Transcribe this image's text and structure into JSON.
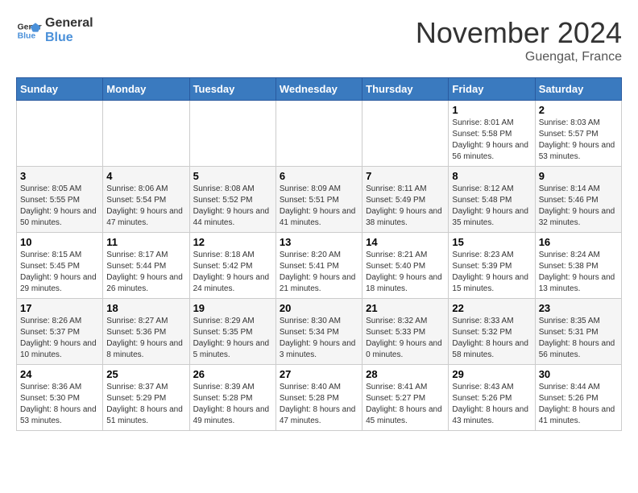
{
  "logo": {
    "line1": "General",
    "line2": "Blue"
  },
  "title": "November 2024",
  "location": "Guengat, France",
  "weekdays": [
    "Sunday",
    "Monday",
    "Tuesday",
    "Wednesday",
    "Thursday",
    "Friday",
    "Saturday"
  ],
  "weeks": [
    [
      {
        "day": "",
        "info": ""
      },
      {
        "day": "",
        "info": ""
      },
      {
        "day": "",
        "info": ""
      },
      {
        "day": "",
        "info": ""
      },
      {
        "day": "",
        "info": ""
      },
      {
        "day": "1",
        "info": "Sunrise: 8:01 AM\nSunset: 5:58 PM\nDaylight: 9 hours and 56 minutes."
      },
      {
        "day": "2",
        "info": "Sunrise: 8:03 AM\nSunset: 5:57 PM\nDaylight: 9 hours and 53 minutes."
      }
    ],
    [
      {
        "day": "3",
        "info": "Sunrise: 8:05 AM\nSunset: 5:55 PM\nDaylight: 9 hours and 50 minutes."
      },
      {
        "day": "4",
        "info": "Sunrise: 8:06 AM\nSunset: 5:54 PM\nDaylight: 9 hours and 47 minutes."
      },
      {
        "day": "5",
        "info": "Sunrise: 8:08 AM\nSunset: 5:52 PM\nDaylight: 9 hours and 44 minutes."
      },
      {
        "day": "6",
        "info": "Sunrise: 8:09 AM\nSunset: 5:51 PM\nDaylight: 9 hours and 41 minutes."
      },
      {
        "day": "7",
        "info": "Sunrise: 8:11 AM\nSunset: 5:49 PM\nDaylight: 9 hours and 38 minutes."
      },
      {
        "day": "8",
        "info": "Sunrise: 8:12 AM\nSunset: 5:48 PM\nDaylight: 9 hours and 35 minutes."
      },
      {
        "day": "9",
        "info": "Sunrise: 8:14 AM\nSunset: 5:46 PM\nDaylight: 9 hours and 32 minutes."
      }
    ],
    [
      {
        "day": "10",
        "info": "Sunrise: 8:15 AM\nSunset: 5:45 PM\nDaylight: 9 hours and 29 minutes."
      },
      {
        "day": "11",
        "info": "Sunrise: 8:17 AM\nSunset: 5:44 PM\nDaylight: 9 hours and 26 minutes."
      },
      {
        "day": "12",
        "info": "Sunrise: 8:18 AM\nSunset: 5:42 PM\nDaylight: 9 hours and 24 minutes."
      },
      {
        "day": "13",
        "info": "Sunrise: 8:20 AM\nSunset: 5:41 PM\nDaylight: 9 hours and 21 minutes."
      },
      {
        "day": "14",
        "info": "Sunrise: 8:21 AM\nSunset: 5:40 PM\nDaylight: 9 hours and 18 minutes."
      },
      {
        "day": "15",
        "info": "Sunrise: 8:23 AM\nSunset: 5:39 PM\nDaylight: 9 hours and 15 minutes."
      },
      {
        "day": "16",
        "info": "Sunrise: 8:24 AM\nSunset: 5:38 PM\nDaylight: 9 hours and 13 minutes."
      }
    ],
    [
      {
        "day": "17",
        "info": "Sunrise: 8:26 AM\nSunset: 5:37 PM\nDaylight: 9 hours and 10 minutes."
      },
      {
        "day": "18",
        "info": "Sunrise: 8:27 AM\nSunset: 5:36 PM\nDaylight: 9 hours and 8 minutes."
      },
      {
        "day": "19",
        "info": "Sunrise: 8:29 AM\nSunset: 5:35 PM\nDaylight: 9 hours and 5 minutes."
      },
      {
        "day": "20",
        "info": "Sunrise: 8:30 AM\nSunset: 5:34 PM\nDaylight: 9 hours and 3 minutes."
      },
      {
        "day": "21",
        "info": "Sunrise: 8:32 AM\nSunset: 5:33 PM\nDaylight: 9 hours and 0 minutes."
      },
      {
        "day": "22",
        "info": "Sunrise: 8:33 AM\nSunset: 5:32 PM\nDaylight: 8 hours and 58 minutes."
      },
      {
        "day": "23",
        "info": "Sunrise: 8:35 AM\nSunset: 5:31 PM\nDaylight: 8 hours and 56 minutes."
      }
    ],
    [
      {
        "day": "24",
        "info": "Sunrise: 8:36 AM\nSunset: 5:30 PM\nDaylight: 8 hours and 53 minutes."
      },
      {
        "day": "25",
        "info": "Sunrise: 8:37 AM\nSunset: 5:29 PM\nDaylight: 8 hours and 51 minutes."
      },
      {
        "day": "26",
        "info": "Sunrise: 8:39 AM\nSunset: 5:28 PM\nDaylight: 8 hours and 49 minutes."
      },
      {
        "day": "27",
        "info": "Sunrise: 8:40 AM\nSunset: 5:28 PM\nDaylight: 8 hours and 47 minutes."
      },
      {
        "day": "28",
        "info": "Sunrise: 8:41 AM\nSunset: 5:27 PM\nDaylight: 8 hours and 45 minutes."
      },
      {
        "day": "29",
        "info": "Sunrise: 8:43 AM\nSunset: 5:26 PM\nDaylight: 8 hours and 43 minutes."
      },
      {
        "day": "30",
        "info": "Sunrise: 8:44 AM\nSunset: 5:26 PM\nDaylight: 8 hours and 41 minutes."
      }
    ]
  ]
}
